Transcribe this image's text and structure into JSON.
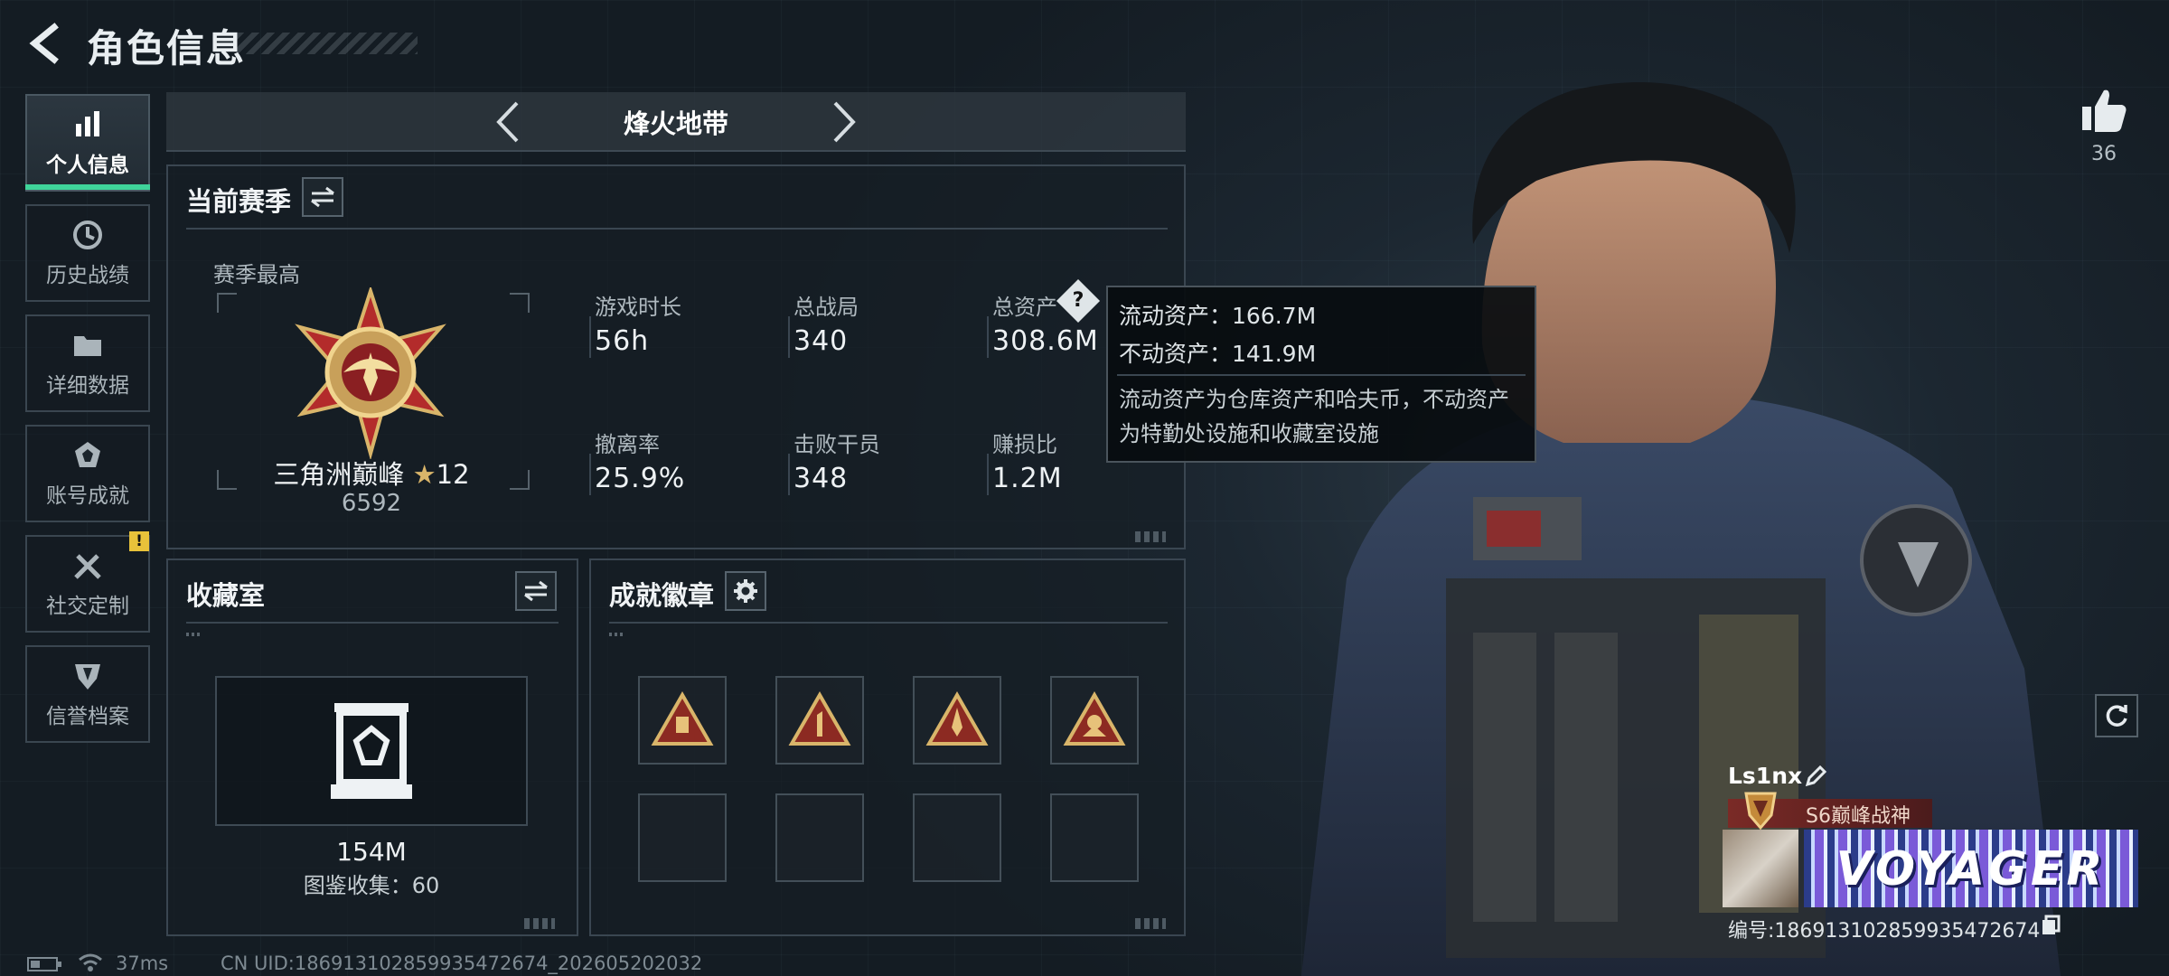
{
  "header": {
    "title": "角色信息",
    "back_icon": "back-arrow-icon"
  },
  "sidebar": {
    "items": [
      {
        "label": "个人信息",
        "icon": "bar-chart-icon",
        "active": true
      },
      {
        "label": "历史战绩",
        "icon": "history-clock-icon",
        "active": false
      },
      {
        "label": "详细数据",
        "icon": "folder-icon",
        "active": false
      },
      {
        "label": "账号成就",
        "icon": "achievement-icon",
        "active": false
      },
      {
        "label": "社交定制",
        "icon": "tools-icon",
        "active": false,
        "alert": "!"
      },
      {
        "label": "信誉档案",
        "icon": "shield-icon",
        "active": false
      }
    ]
  },
  "mode": {
    "label": "烽火地带"
  },
  "season": {
    "title": "当前赛季",
    "best_label": "赛季最高",
    "rank_name": "三角洲巅峰",
    "rank_stars": "12",
    "rank_score": "6592",
    "stats": [
      {
        "label": "游戏时长",
        "value": "56h"
      },
      {
        "label": "总战局",
        "value": "340"
      },
      {
        "label": "总资产",
        "value": "308.6M"
      },
      {
        "label": "撤离率",
        "value": "25.9%"
      },
      {
        "label": "击败干员",
        "value": "348"
      },
      {
        "label": "赚损比",
        "value": "1.2M"
      }
    ],
    "help_glyph": "?"
  },
  "tooltip": {
    "liquid": "流动资产：166.7M",
    "fixed": "不动资产：141.9M",
    "desc_line1": "流动资产为仓库资产和哈夫币，不动资产",
    "desc_line2": "为特勤处设施和收藏室设施"
  },
  "collection": {
    "title": "收藏室",
    "value": "154M",
    "catalog": "图鉴收集：60"
  },
  "badges": {
    "title": "成就徽章",
    "items": [
      "badge-1-icon",
      "badge-2-icon",
      "badge-3-icon",
      "badge-4-icon",
      "",
      "",
      "",
      ""
    ]
  },
  "profile": {
    "likes": "36",
    "name": "Ls1nx",
    "title_badge": "S6巅峰战神",
    "banner_text": "VOYAGER",
    "uid_line": "编号:186913102859935472674"
  },
  "status": {
    "ping": "37ms",
    "uid_footer": "CN UID:186913102859935472674_202605202032"
  },
  "colors": {
    "accent": "#3fd49a",
    "alert": "#e8c23a",
    "title_red": "#7a2a26"
  }
}
